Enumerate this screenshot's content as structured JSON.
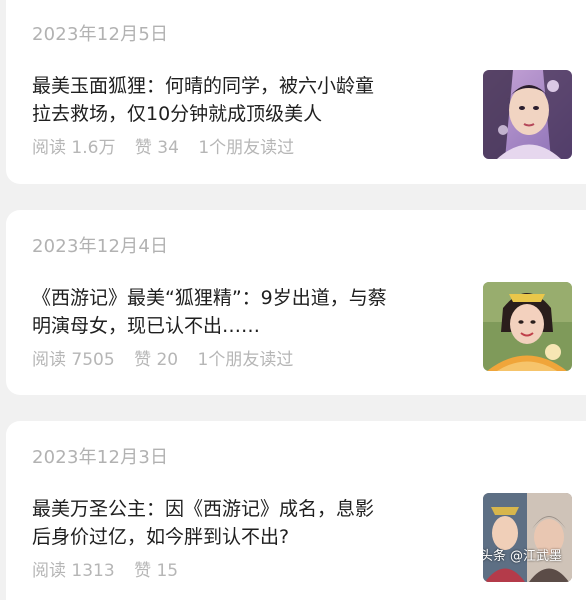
{
  "articles": [
    {
      "date": "2023年12月5日",
      "title_line1": "最美玉面狐狸：何晴的同学，被六小龄童",
      "title_line2": "拉去救场，仅10分钟就成顶级美人",
      "reads": "阅读 1.6万",
      "likes": "赞 34",
      "friends": "1个朋友读过"
    },
    {
      "date": "2023年12月4日",
      "title_line1": "《西游记》最美“狐狸精”：9岁出道，与蔡",
      "title_line2": "明演母女，现已认不出……",
      "reads": "阅读 7505",
      "likes": "赞 20",
      "friends": "1个朋友读过"
    },
    {
      "date": "2023年12月3日",
      "title_line1": "最美万圣公主：因《西游记》成名，息影",
      "title_line2": "后身价过亿，如今胖到认不出?",
      "reads": "阅读 1313",
      "likes": "赞 15",
      "friends": ""
    }
  ],
  "watermark": "头条 @江武墨"
}
